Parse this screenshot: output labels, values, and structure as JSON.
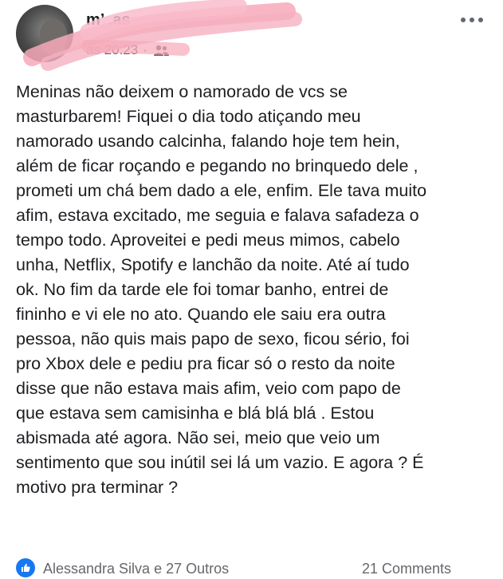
{
  "post": {
    "author_visible": "m’ .as",
    "timestamp": "às 20:23",
    "separator": "·",
    "audience_icon": "friends-icon",
    "more_icon": "more-options-icon",
    "text_lines": [
      "Meninas não deixem o namorado de vcs se",
      "masturbarem! Fiquei o dia todo atiçando meu",
      "namorado usando calcinha, falando hoje tem hein,",
      "além de ficar roçando e pegando no brinquedo dele ,",
      "prometi um chá bem dado a ele, enfim. Ele tava muito",
      "afim, estava excitado, me seguia e falava safadeza o",
      "tempo todo. Aproveitei e pedi meus mimos, cabelo",
      "unha, Netflix, Spotify e lanchão da noite. Até aí tudo",
      "ok. No fim da tarde ele foi tomar banho, entrei de",
      "fininho e vi ele no ato. Quando ele saiu era outra",
      "pessoa, não quis mais papo de sexo, ficou sério, foi",
      "pro Xbox dele e pediu pra ficar só o resto da noite",
      "disse que não estava mais afim, veio com papo de",
      "que estava sem camisinha e blá blá blá . Estou",
      "abismada até agora. Não sei, meio que veio um",
      "sentimento que sou inútil sei lá um vazio. E agora ? É",
      "motivo pra terminar ?"
    ]
  },
  "footer": {
    "reaction_icon": "like-icon",
    "reactors": "Alessandra Silva e 27 Outros",
    "comments": "21 Comments"
  },
  "colors": {
    "redaction_scribble": "#f7a8b8",
    "accent": "#1877f2",
    "secondary_text": "#65676b"
  }
}
